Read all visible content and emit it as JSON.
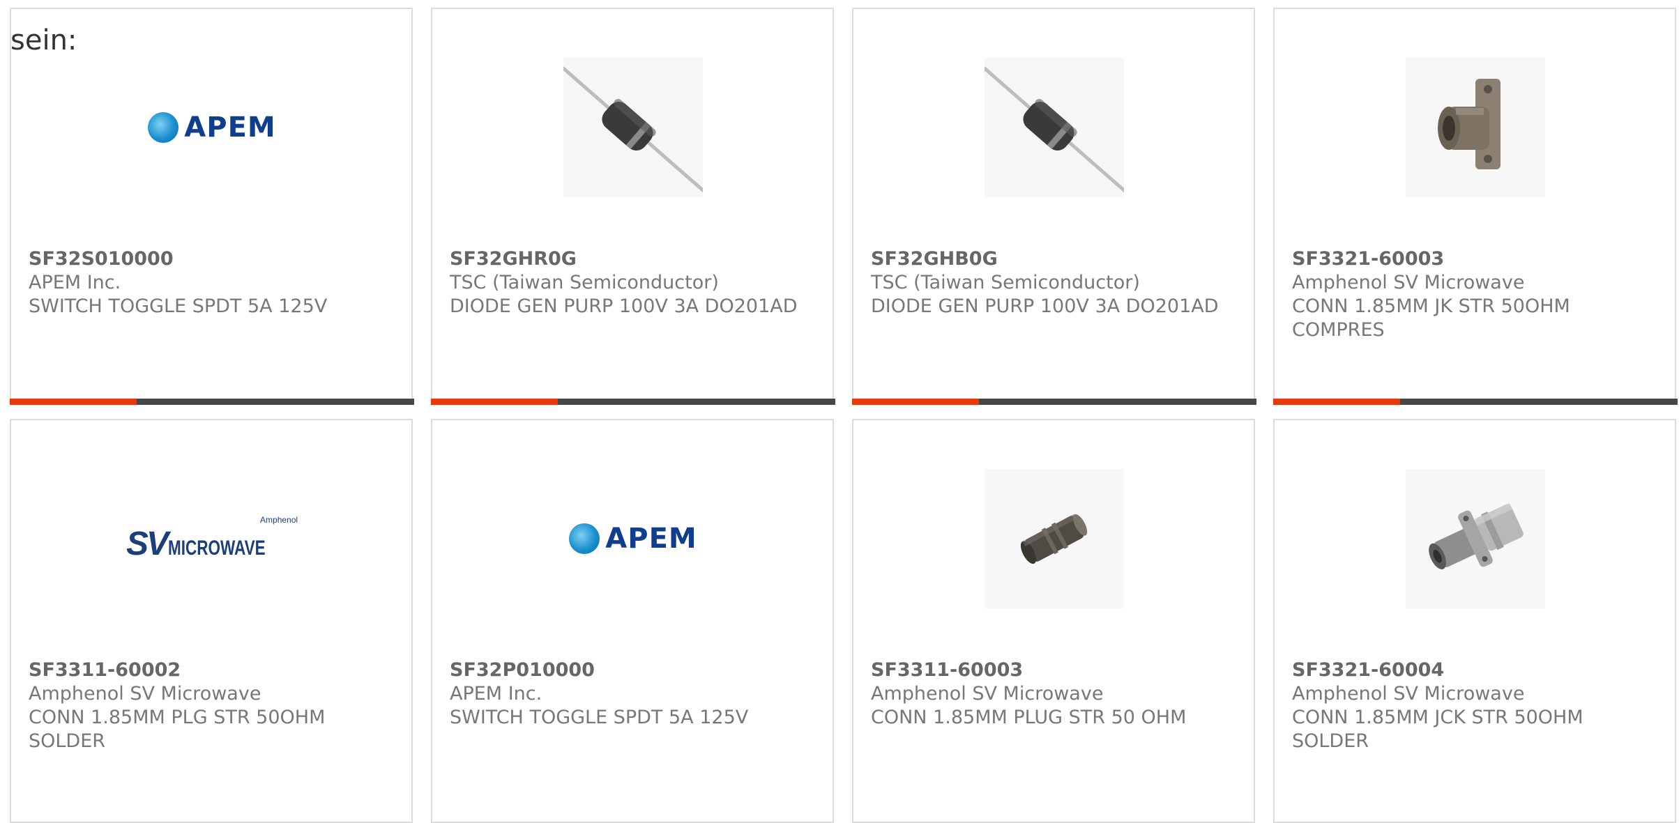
{
  "intro_text": "sein:",
  "products": [
    {
      "part": "SF32S010000",
      "manufacturer": "APEM Inc.",
      "description": "SWITCH TOGGLE SPDT 5A 125V",
      "image": "apem-logo"
    },
    {
      "part": "SF32GHR0G",
      "manufacturer": "TSC (Taiwan Semiconductor)",
      "description": "DIODE GEN PURP 100V 3A DO201AD",
      "image": "axial-diode"
    },
    {
      "part": "SF32GHB0G",
      "manufacturer": "TSC (Taiwan Semiconductor)",
      "description": "DIODE GEN PURP 100V 3A DO201AD",
      "image": "axial-diode"
    },
    {
      "part": "SF3321-60003",
      "manufacturer": "Amphenol SV Microwave",
      "description": "CONN 1.85MM JK STR 50OHM COMPRES",
      "image": "flange-jack-connector"
    },
    {
      "part": "SF3311-60002",
      "manufacturer": "Amphenol SV Microwave",
      "description": "CONN 1.85MM PLG STR 50OHM SOLDER",
      "image": "sv-microwave-logo"
    },
    {
      "part": "SF32P010000",
      "manufacturer": "APEM Inc.",
      "description": "SWITCH TOGGLE SPDT 5A 125V",
      "image": "apem-logo"
    },
    {
      "part": "SF3311-60003",
      "manufacturer": "Amphenol SV Microwave",
      "description": "CONN 1.85MM PLUG STR 50 OHM",
      "image": "plug-connector"
    },
    {
      "part": "SF3321-60004",
      "manufacturer": "Amphenol SV Microwave",
      "description": "CONN 1.85MM JCK STR 50OHM SOLDER",
      "image": "bulkhead-jack-connector"
    }
  ],
  "sv_logo": {
    "brand_small": "Amphenol",
    "brand_big": "SV",
    "brand_word": "MICROWAVE"
  },
  "apem_logo": {
    "wordmark": "APEM"
  },
  "colors": {
    "accent": "#e8380d",
    "bar": "#474747",
    "border": "#dcdcdc"
  }
}
